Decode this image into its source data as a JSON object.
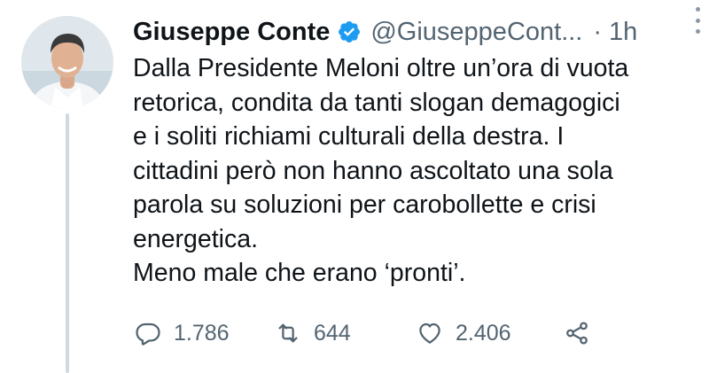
{
  "author": {
    "name": "Giuseppe Conte",
    "handle": "@GiuseppeCont...",
    "verified": true,
    "separator": "·",
    "time": "1h"
  },
  "tweet": {
    "lines": [
      "Dalla Presidente Meloni oltre un’ora di vuota",
      "retorica, condita da tanti slogan demagogici",
      "e i soliti richiami culturali della destra. I",
      "cittadini però non hanno ascoltato una sola",
      "parola su soluzioni per carobollette e crisi",
      "energetica.",
      "Meno male che erano ‘pronti’."
    ]
  },
  "actions": {
    "replies": "1.786",
    "retweets": "644",
    "likes": "2.406"
  },
  "icons": {
    "avatar": "profile-photo",
    "verified": "verified-badge-icon",
    "reply": "reply-icon",
    "retweet": "retweet-icon",
    "like": "heart-icon",
    "share": "share-icon",
    "more": "more-options-icon"
  },
  "colors": {
    "text": "#0f1419",
    "secondary": "#536471",
    "verified": "#1d9bf0",
    "thread_line": "#cfd9de"
  }
}
